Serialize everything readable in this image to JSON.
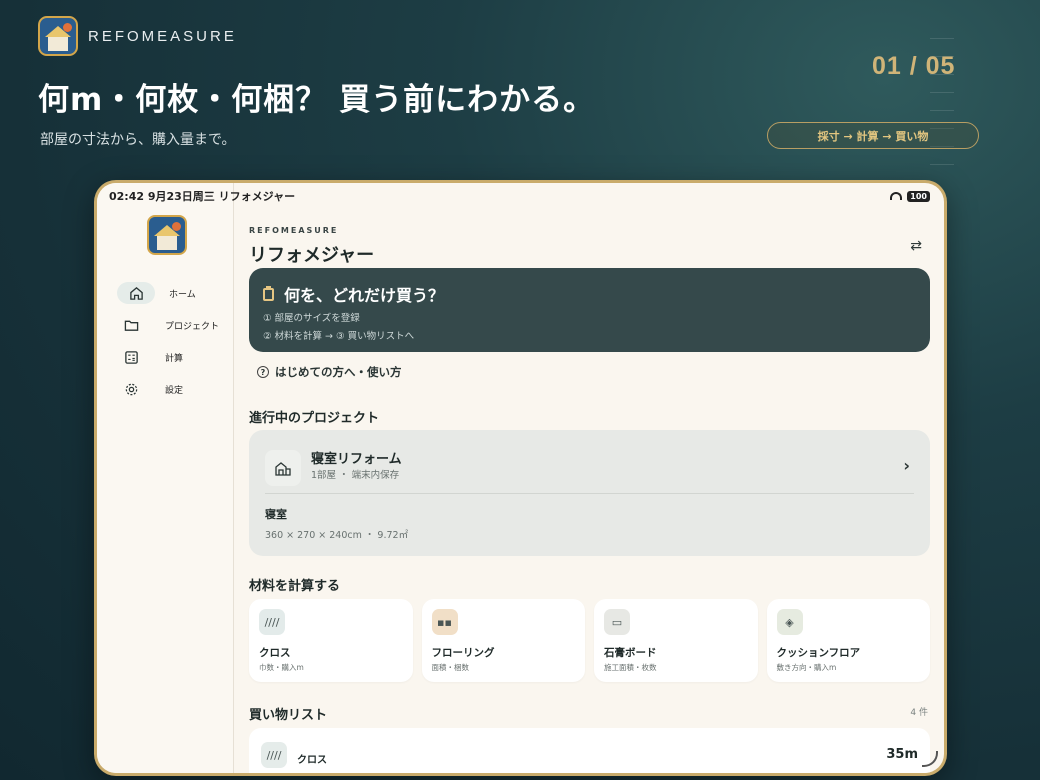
{
  "brand": {
    "name": "REFOMEASURE",
    "logo_icon": "app-logo-icon"
  },
  "headline": "何m・何枚・何梱？ 買う前にわかる。",
  "subline": "部屋の寸法から、購入量まで。",
  "page_counter": "01 / 05",
  "steps_pill": "採寸 → 計算 → 買い物",
  "status_bar": {
    "time_date": "02:42  9月23日周三  リフォメジャー",
    "battery": "100"
  },
  "sidebar": {
    "items": [
      {
        "label": "ホーム",
        "icon": "home-icon",
        "active": true
      },
      {
        "label": "プロジェクト",
        "icon": "folder-icon",
        "active": false
      },
      {
        "label": "計算",
        "icon": "calculator-icon",
        "active": false
      },
      {
        "label": "設定",
        "icon": "gear-icon",
        "active": false
      }
    ]
  },
  "app": {
    "kicker": "REFOMEASURE",
    "title": "リフォメジャー",
    "swap_icon": "⇄"
  },
  "hero": {
    "title": "何を、どれだけ買う？",
    "line1": "① 部屋のサイズを登録",
    "line2": "② 材料を計算 → ③ 買い物リストへ"
  },
  "howto": {
    "icon": "?",
    "label": "はじめての方へ・使い方"
  },
  "projects": {
    "heading": "進行中のプロジェクト",
    "card": {
      "name": "寝室リフォーム",
      "meta": "1部屋 ・ 端末内保存",
      "room_name": "寝室",
      "room_size": "360 × 270 × 240cm ・ 9.72㎡"
    }
  },
  "calculate": {
    "heading": "材料を計算する",
    "items": [
      {
        "name": "クロス",
        "sub": "巾数・購入m",
        "icon": "////",
        "icon_bg": "#e3ebea"
      },
      {
        "name": "フローリング",
        "sub": "面積・梱数",
        "icon": "▪▪",
        "icon_bg": "#f1dfc7"
      },
      {
        "name": "石膏ボード",
        "sub": "施工面積・枚数",
        "icon": "▭",
        "icon_bg": "#e7e8e4"
      },
      {
        "name": "クッションフロア",
        "sub": "敷き方向・購入m",
        "icon": "◈",
        "icon_bg": "#e6ebe0"
      }
    ]
  },
  "shopping": {
    "heading": "買い物リスト",
    "count": "4 件",
    "first_item": {
      "name": "クロス",
      "qty": "35m",
      "icon": "////"
    }
  },
  "colors": {
    "accent_gold": "#d0b478",
    "hero_bg": "#35494b",
    "page_bg": "#163038"
  }
}
